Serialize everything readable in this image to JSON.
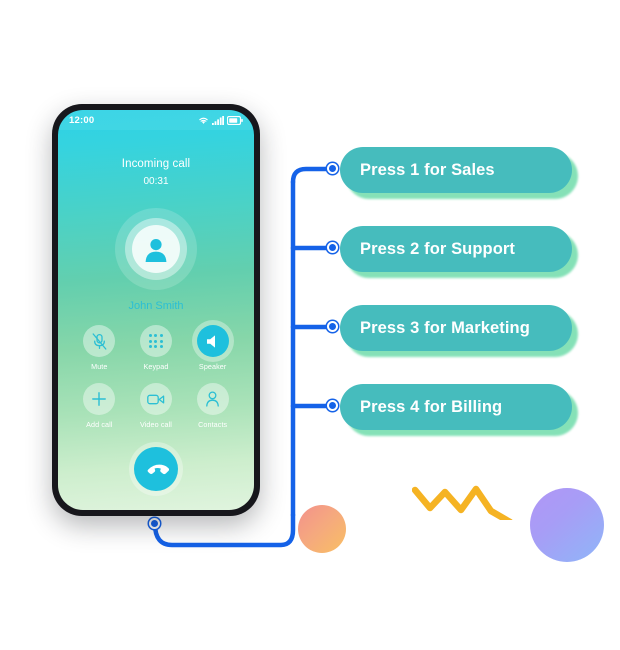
{
  "phone": {
    "status_bar": {
      "time": "12:00",
      "icons": [
        "wifi-icon",
        "signal-icon",
        "battery-icon"
      ]
    },
    "call": {
      "title": "Incoming call",
      "timer": "00:31",
      "caller_name": "John Smith",
      "avatar_icon": "person-avatar-icon"
    },
    "controls": [
      {
        "label": "Mute",
        "icon": "microphone-muted-icon",
        "active": false
      },
      {
        "label": "Keypad",
        "icon": "keypad-dots-icon",
        "active": false
      },
      {
        "label": "Speaker",
        "icon": "speaker-icon",
        "active": true
      },
      {
        "label": "Add call",
        "icon": "plus-icon",
        "active": false
      },
      {
        "label": "Video call",
        "icon": "video-camera-icon",
        "active": false
      },
      {
        "label": "Contacts",
        "icon": "contact-person-icon",
        "active": false
      }
    ],
    "end_call": {
      "label": "End call",
      "icon": "phone-hangup-icon"
    }
  },
  "menu": {
    "options": [
      {
        "label": "Press 1 for Sales"
      },
      {
        "label": "Press 2 for Support"
      },
      {
        "label": "Press 3 for Marketing"
      },
      {
        "label": "Press 4 for Billing"
      }
    ]
  },
  "colors": {
    "pill_fill": "#46bcbd",
    "pill_glow": "#7fe0b4",
    "connector_line": "#1562e8",
    "node_dot": "#1562e8",
    "accent_cyan": "#1ec0dd",
    "screen_top": "#2ed2e6",
    "screen_bottom": "#e0f4de",
    "phone_frame": "#17171c",
    "zigzag": "#f5b323",
    "blob_orange": "#f5a97e",
    "blob_purple": "#a79df6"
  }
}
